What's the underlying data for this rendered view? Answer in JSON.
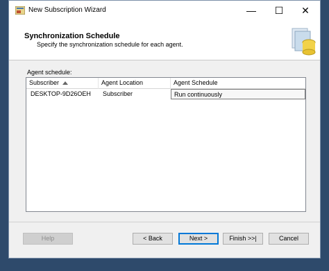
{
  "window": {
    "title": "New Subscription Wizard",
    "minimize_glyph": "—",
    "maximize_glyph": "☐",
    "close_glyph": "✕"
  },
  "header": {
    "title": "Synchronization Schedule",
    "subtitle": "Specify the synchronization schedule for each agent."
  },
  "schedule": {
    "label": "Agent schedule:",
    "columns": [
      "Subscriber",
      "Agent Location",
      "Agent Schedule"
    ],
    "rows": [
      {
        "subscriber": "DESKTOP-9D26OEH",
        "location": "Subscriber",
        "schedule": "Run continuously"
      }
    ]
  },
  "buttons": {
    "help": "Help",
    "back": "< Back",
    "next": "Next >",
    "finish": "Finish >>|",
    "cancel": "Cancel"
  },
  "colors": {
    "desktop": "#2e4a6b",
    "accent": "#0078d7"
  }
}
